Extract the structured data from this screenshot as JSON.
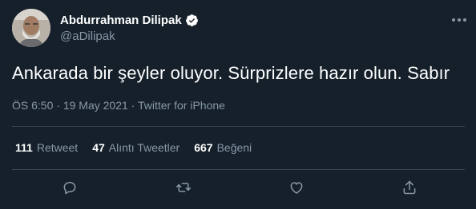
{
  "author": {
    "display_name": "Abdurrahman Dilipak",
    "handle": "@aDilipak"
  },
  "tweet": {
    "text": "Ankarada bir şeyler oluyor. Sürprizlere hazır olun. Sabır",
    "time": "ÖS 6:50",
    "date": "19 May 2021",
    "source": "Twitter for iPhone",
    "separator": "·"
  },
  "stats": {
    "retweets": {
      "count": "111",
      "label": "Retweet"
    },
    "quotes": {
      "count": "47",
      "label": "Alıntı Tweetler"
    },
    "likes": {
      "count": "667",
      "label": "Beğeni"
    }
  },
  "icons": {
    "verified": "verified-badge-icon",
    "more": "more-icon",
    "reply": "reply-icon",
    "retweet": "retweet-icon",
    "like": "like-icon",
    "share": "share-icon"
  },
  "colors": {
    "background": "#15202b",
    "text": "#ffffff",
    "secondary": "#8899a6",
    "divider": "#38444d"
  }
}
